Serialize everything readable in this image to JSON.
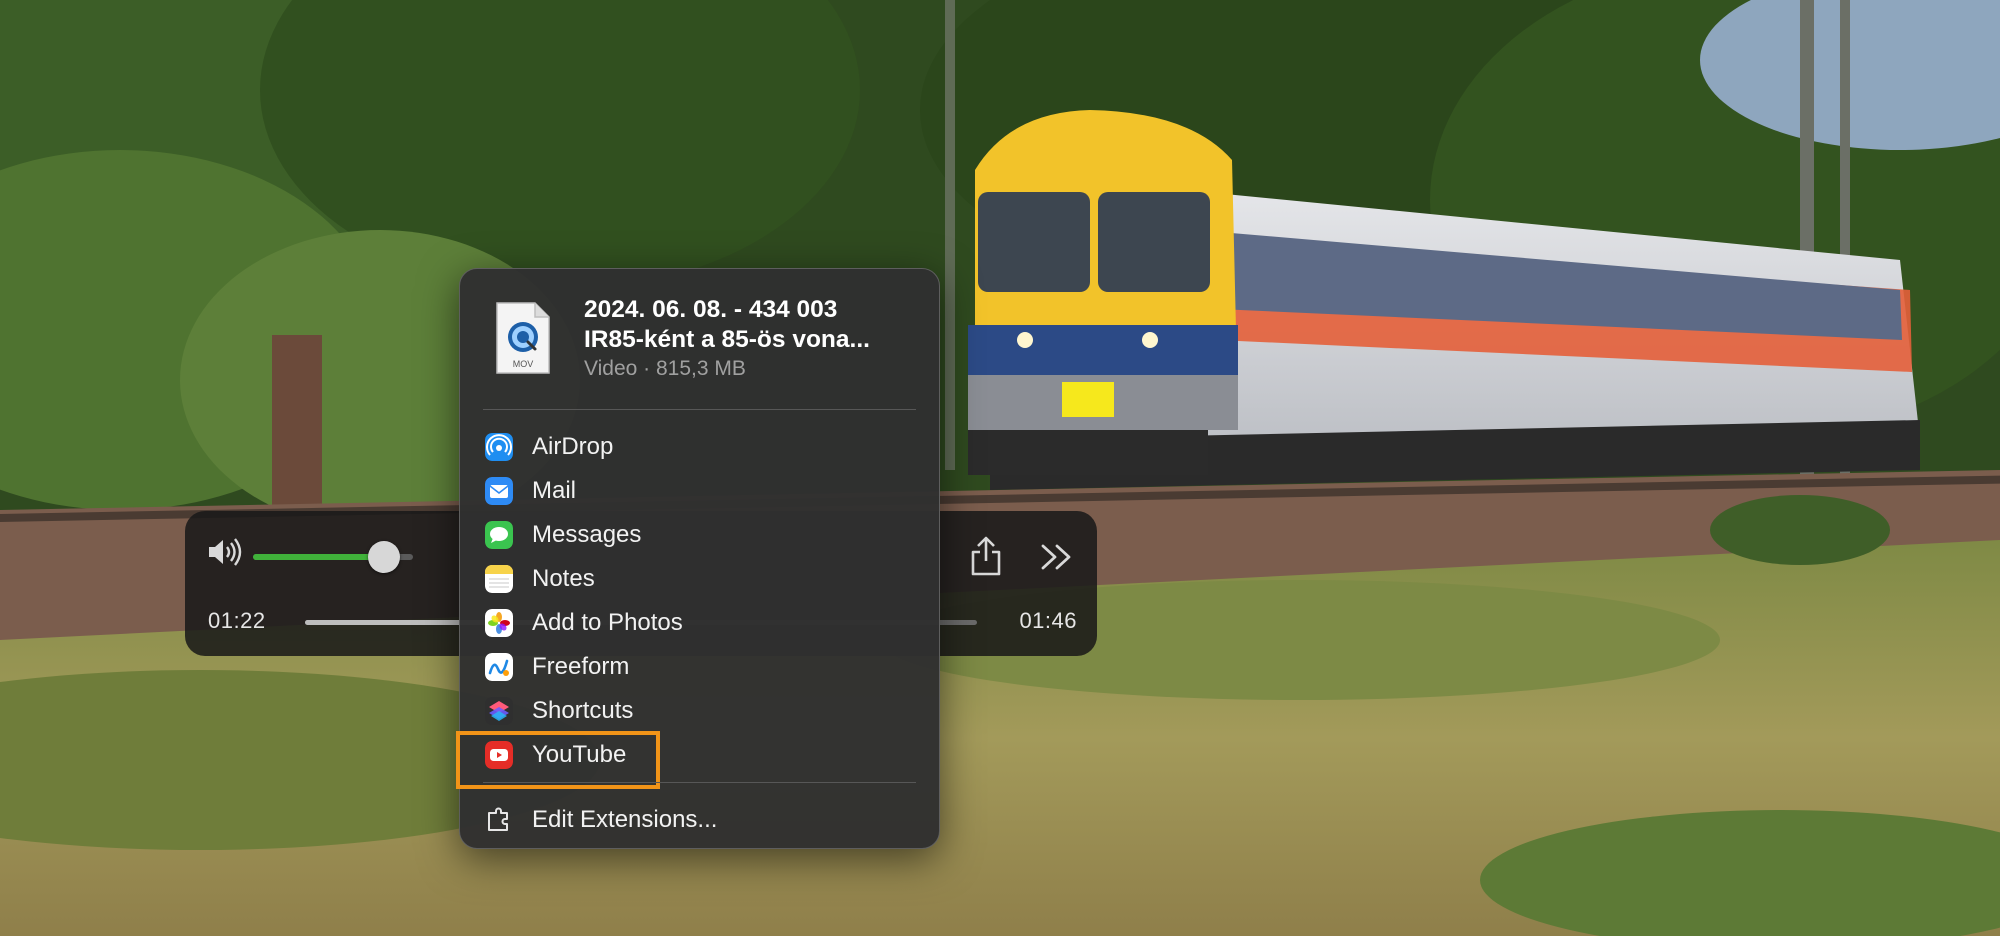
{
  "player": {
    "time_elapsed": "01:22",
    "time_remaining": "01:46",
    "volume_level": 0.82,
    "playback_progress": 0.35,
    "volume_color": "#40b23a"
  },
  "share_menu": {
    "file": {
      "title_line1": "2024. 06. 08. - 434 003",
      "title_line2": "IR85-ként a 85-ös vona...",
      "subtitle": "Video · 815,3 MB",
      "icon_badge": "MOV"
    },
    "items": [
      {
        "label": "AirDrop",
        "icon": "airdrop-icon",
        "color": "#1f8ef1"
      },
      {
        "label": "Mail",
        "icon": "mail-icon",
        "color": "#2e8bf5"
      },
      {
        "label": "Messages",
        "icon": "messages-icon",
        "color": "#3ac44f"
      },
      {
        "label": "Notes",
        "icon": "notes-icon",
        "color": "#f7d34a"
      },
      {
        "label": "Add to Photos",
        "icon": "photos-icon",
        "color": "#ffffff"
      },
      {
        "label": "Freeform",
        "icon": "freeform-icon",
        "color": "#ffffff"
      },
      {
        "label": "Shortcuts",
        "icon": "shortcuts-icon",
        "color": "#7b52d6"
      },
      {
        "label": "YouTube",
        "icon": "youtube-icon",
        "color": "#e52d27",
        "highlighted": true
      }
    ],
    "edit_extensions_label": "Edit Extensions...",
    "highlight_color": "#f29418"
  }
}
